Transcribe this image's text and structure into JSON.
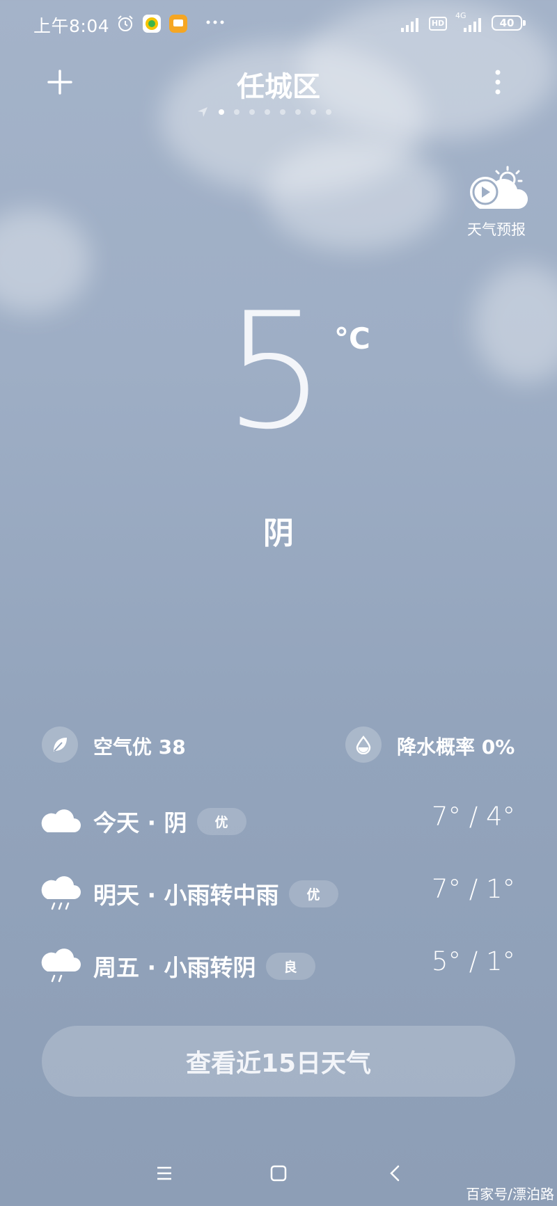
{
  "status_bar": {
    "time": "上午8:04",
    "battery": "40",
    "network": "4G",
    "hd_label": "HD"
  },
  "header": {
    "city": "任城区",
    "page_count": 9,
    "active_page": 0
  },
  "forecast_button": {
    "label": "天气预报",
    "icon": "play-cloud-sun-icon"
  },
  "current": {
    "temperature": "5",
    "unit": "°C",
    "condition": "阴"
  },
  "info": {
    "air_quality": "空气优 38",
    "precipitation": "降水概率 0%"
  },
  "daily": [
    {
      "label": "今天 · 阴",
      "aqi": "优",
      "temps": "7° / 4°",
      "icon": "cloud-icon"
    },
    {
      "label": "明天 · 小雨转中雨",
      "aqi": "优",
      "temps": "7° / 1°",
      "icon": "rain-cloud-icon"
    },
    {
      "label": "周五 · 小雨转阴",
      "aqi": "良",
      "temps": "5° / 1°",
      "icon": "rain-cloud-icon"
    }
  ],
  "more_button": "查看近15日天气",
  "watermark": "百家号/漂泊路",
  "colors": {
    "background_top": "#a4b3c9",
    "background_bottom": "#8d9eb6"
  }
}
